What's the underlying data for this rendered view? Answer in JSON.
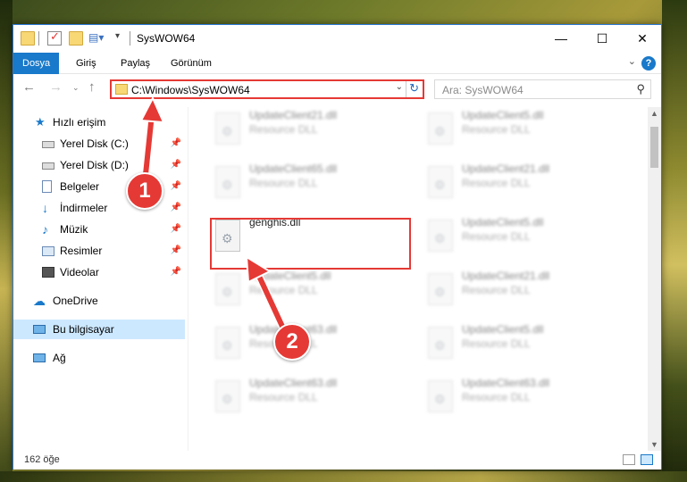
{
  "window": {
    "title": "SysWOW64",
    "minimize": "—",
    "maximize": "☐",
    "close": "✕"
  },
  "ribbon": {
    "tabs": [
      "Dosya",
      "Giriş",
      "Paylaş",
      "Görünüm"
    ],
    "help": "?"
  },
  "address": {
    "path": "C:\\Windows\\SysWOW64",
    "search_placeholder": "Ara: SysWOW64"
  },
  "sidebar": {
    "items": [
      {
        "label": "Hızlı erişim"
      },
      {
        "label": "Yerel Disk (C:)"
      },
      {
        "label": "Yerel Disk (D:)"
      },
      {
        "label": "Belgeler"
      },
      {
        "label": "İndirmeler"
      },
      {
        "label": "Müzik"
      },
      {
        "label": "Resimler"
      },
      {
        "label": "Videolar"
      },
      {
        "label": "OneDrive"
      },
      {
        "label": "Bu bilgisayar"
      },
      {
        "label": "Ağ"
      }
    ]
  },
  "files": {
    "left": [
      {
        "name": "UpdateClient21.dll",
        "type": "Resource DLL"
      },
      {
        "name": "UpdateClient65.dll",
        "type": "Resource DLL"
      },
      {
        "name": "genghis.dll",
        "type": ""
      },
      {
        "name": "UpdateClient5.dll",
        "type": "Resource DLL"
      },
      {
        "name": "UpdateClient63.dll",
        "type": "Resource DLL"
      },
      {
        "name": "UpdateClient63.dll",
        "type": "Resource DLL"
      }
    ],
    "right": [
      {
        "name": "UpdateClient5.dll",
        "type": "Resource DLL"
      },
      {
        "name": "UpdateClient21.dll",
        "type": "Resource DLL"
      },
      {
        "name": "UpdateClient5.dll",
        "type": "Resource DLL"
      },
      {
        "name": "UpdateClient21.dll",
        "type": "Resource DLL"
      },
      {
        "name": "UpdateClient5.dll",
        "type": "Resource DLL"
      },
      {
        "name": "UpdateClient63.dll",
        "type": "Resource DLL"
      }
    ]
  },
  "status": {
    "count": "162 öğe"
  },
  "callouts": {
    "one": "1",
    "two": "2"
  },
  "colors": {
    "accent": "#1979ca",
    "annotation": "#e53935",
    "selection": "#cce8ff"
  }
}
